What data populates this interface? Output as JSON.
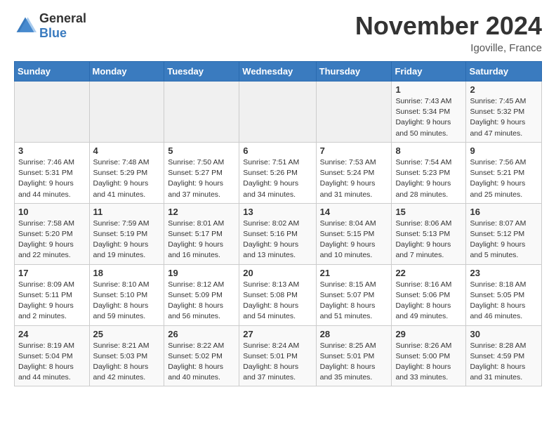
{
  "header": {
    "logo_general": "General",
    "logo_blue": "Blue",
    "month_title": "November 2024",
    "location": "Igoville, France"
  },
  "days_of_week": [
    "Sunday",
    "Monday",
    "Tuesday",
    "Wednesday",
    "Thursday",
    "Friday",
    "Saturday"
  ],
  "weeks": [
    [
      {
        "day": "",
        "info": ""
      },
      {
        "day": "",
        "info": ""
      },
      {
        "day": "",
        "info": ""
      },
      {
        "day": "",
        "info": ""
      },
      {
        "day": "",
        "info": ""
      },
      {
        "day": "1",
        "info": "Sunrise: 7:43 AM\nSunset: 5:34 PM\nDaylight: 9 hours\nand 50 minutes."
      },
      {
        "day": "2",
        "info": "Sunrise: 7:45 AM\nSunset: 5:32 PM\nDaylight: 9 hours\nand 47 minutes."
      }
    ],
    [
      {
        "day": "3",
        "info": "Sunrise: 7:46 AM\nSunset: 5:31 PM\nDaylight: 9 hours\nand 44 minutes."
      },
      {
        "day": "4",
        "info": "Sunrise: 7:48 AM\nSunset: 5:29 PM\nDaylight: 9 hours\nand 41 minutes."
      },
      {
        "day": "5",
        "info": "Sunrise: 7:50 AM\nSunset: 5:27 PM\nDaylight: 9 hours\nand 37 minutes."
      },
      {
        "day": "6",
        "info": "Sunrise: 7:51 AM\nSunset: 5:26 PM\nDaylight: 9 hours\nand 34 minutes."
      },
      {
        "day": "7",
        "info": "Sunrise: 7:53 AM\nSunset: 5:24 PM\nDaylight: 9 hours\nand 31 minutes."
      },
      {
        "day": "8",
        "info": "Sunrise: 7:54 AM\nSunset: 5:23 PM\nDaylight: 9 hours\nand 28 minutes."
      },
      {
        "day": "9",
        "info": "Sunrise: 7:56 AM\nSunset: 5:21 PM\nDaylight: 9 hours\nand 25 minutes."
      }
    ],
    [
      {
        "day": "10",
        "info": "Sunrise: 7:58 AM\nSunset: 5:20 PM\nDaylight: 9 hours\nand 22 minutes."
      },
      {
        "day": "11",
        "info": "Sunrise: 7:59 AM\nSunset: 5:19 PM\nDaylight: 9 hours\nand 19 minutes."
      },
      {
        "day": "12",
        "info": "Sunrise: 8:01 AM\nSunset: 5:17 PM\nDaylight: 9 hours\nand 16 minutes."
      },
      {
        "day": "13",
        "info": "Sunrise: 8:02 AM\nSunset: 5:16 PM\nDaylight: 9 hours\nand 13 minutes."
      },
      {
        "day": "14",
        "info": "Sunrise: 8:04 AM\nSunset: 5:15 PM\nDaylight: 9 hours\nand 10 minutes."
      },
      {
        "day": "15",
        "info": "Sunrise: 8:06 AM\nSunset: 5:13 PM\nDaylight: 9 hours\nand 7 minutes."
      },
      {
        "day": "16",
        "info": "Sunrise: 8:07 AM\nSunset: 5:12 PM\nDaylight: 9 hours\nand 5 minutes."
      }
    ],
    [
      {
        "day": "17",
        "info": "Sunrise: 8:09 AM\nSunset: 5:11 PM\nDaylight: 9 hours\nand 2 minutes."
      },
      {
        "day": "18",
        "info": "Sunrise: 8:10 AM\nSunset: 5:10 PM\nDaylight: 8 hours\nand 59 minutes."
      },
      {
        "day": "19",
        "info": "Sunrise: 8:12 AM\nSunset: 5:09 PM\nDaylight: 8 hours\nand 56 minutes."
      },
      {
        "day": "20",
        "info": "Sunrise: 8:13 AM\nSunset: 5:08 PM\nDaylight: 8 hours\nand 54 minutes."
      },
      {
        "day": "21",
        "info": "Sunrise: 8:15 AM\nSunset: 5:07 PM\nDaylight: 8 hours\nand 51 minutes."
      },
      {
        "day": "22",
        "info": "Sunrise: 8:16 AM\nSunset: 5:06 PM\nDaylight: 8 hours\nand 49 minutes."
      },
      {
        "day": "23",
        "info": "Sunrise: 8:18 AM\nSunset: 5:05 PM\nDaylight: 8 hours\nand 46 minutes."
      }
    ],
    [
      {
        "day": "24",
        "info": "Sunrise: 8:19 AM\nSunset: 5:04 PM\nDaylight: 8 hours\nand 44 minutes."
      },
      {
        "day": "25",
        "info": "Sunrise: 8:21 AM\nSunset: 5:03 PM\nDaylight: 8 hours\nand 42 minutes."
      },
      {
        "day": "26",
        "info": "Sunrise: 8:22 AM\nSunset: 5:02 PM\nDaylight: 8 hours\nand 40 minutes."
      },
      {
        "day": "27",
        "info": "Sunrise: 8:24 AM\nSunset: 5:01 PM\nDaylight: 8 hours\nand 37 minutes."
      },
      {
        "day": "28",
        "info": "Sunrise: 8:25 AM\nSunset: 5:01 PM\nDaylight: 8 hours\nand 35 minutes."
      },
      {
        "day": "29",
        "info": "Sunrise: 8:26 AM\nSunset: 5:00 PM\nDaylight: 8 hours\nand 33 minutes."
      },
      {
        "day": "30",
        "info": "Sunrise: 8:28 AM\nSunset: 4:59 PM\nDaylight: 8 hours\nand 31 minutes."
      }
    ]
  ]
}
